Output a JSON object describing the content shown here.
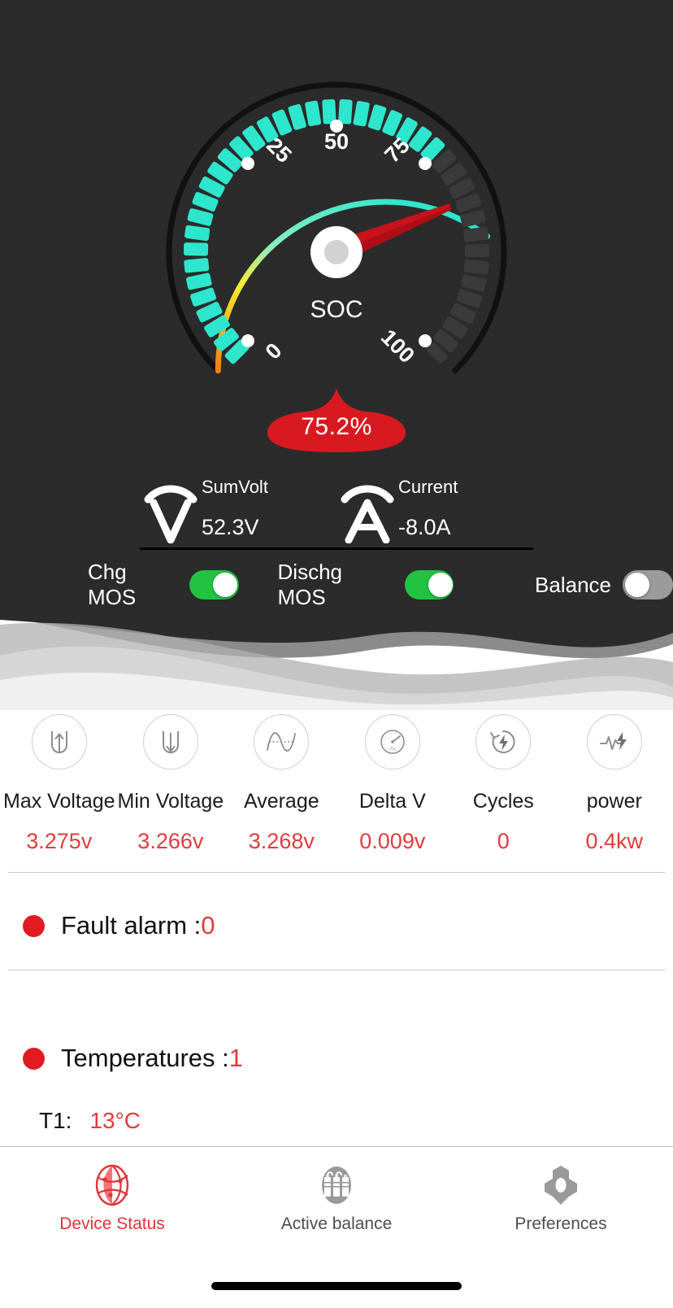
{
  "gauge": {
    "center_label": "SOC",
    "value": 75.2,
    "value_label": "75.2%",
    "min": 0,
    "max": 100,
    "tick_labels": [
      "0",
      "25",
      "50",
      "75",
      "100"
    ],
    "needle_color": "#c9121a",
    "active_tick_color": "#2ee6cd",
    "inactive_tick_color": "#3a3a3a",
    "arc_colors": [
      "#f08a1c",
      "#f5e531",
      "#2ee6cd"
    ],
    "badge_color": "#d81a20"
  },
  "meters": [
    {
      "icon": "voltmeter-icon",
      "label": "SumVolt",
      "value": "52.3V",
      "glyph": "V"
    },
    {
      "icon": "ammeter-icon",
      "label": "Current",
      "value": "-8.0A",
      "glyph": "A"
    }
  ],
  "toggles": [
    {
      "name": "chg-mos",
      "label": "Chg MOS",
      "state": "on"
    },
    {
      "name": "dischg-mos",
      "label": "Dischg MOS",
      "state": "on"
    },
    {
      "name": "balance",
      "label": "Balance",
      "state": "off"
    }
  ],
  "metrics": [
    {
      "icon": "cell-max-voltage-icon",
      "label": "Max Voltage",
      "value": "3.275v"
    },
    {
      "icon": "cell-min-voltage-icon",
      "label": "Min Voltage",
      "value": "3.266v"
    },
    {
      "icon": "sine-wave-icon",
      "label": "Average",
      "value": "3.268v"
    },
    {
      "icon": "pressure-gauge-icon",
      "label": "Delta V",
      "value": "0.009v"
    },
    {
      "icon": "cycle-bolt-icon",
      "label": "Cycles",
      "value": "0"
    },
    {
      "icon": "pulse-bolt-icon",
      "label": "power",
      "value": "0.4kw"
    }
  ],
  "fault": {
    "label": "Fault alarm :",
    "value": "0"
  },
  "temperatures": {
    "label": "Temperatures :",
    "count": "1",
    "sensors": [
      {
        "key": "T1:",
        "value": "13°C"
      }
    ]
  },
  "tabs": [
    {
      "name": "device-status",
      "icon": "globe-network-icon",
      "label": "Device Status",
      "active": true
    },
    {
      "name": "active-balance",
      "icon": "battery-cells-icon",
      "label": "Active balance",
      "active": false
    },
    {
      "name": "preferences",
      "icon": "gear-hex-icon",
      "label": "Preferences",
      "active": false
    }
  ],
  "colors": {
    "panel_bg": "#2b2b2b",
    "accent_red": "#e23b3b",
    "toggle_on": "#23c342",
    "toggle_off": "#9b9b9b"
  }
}
